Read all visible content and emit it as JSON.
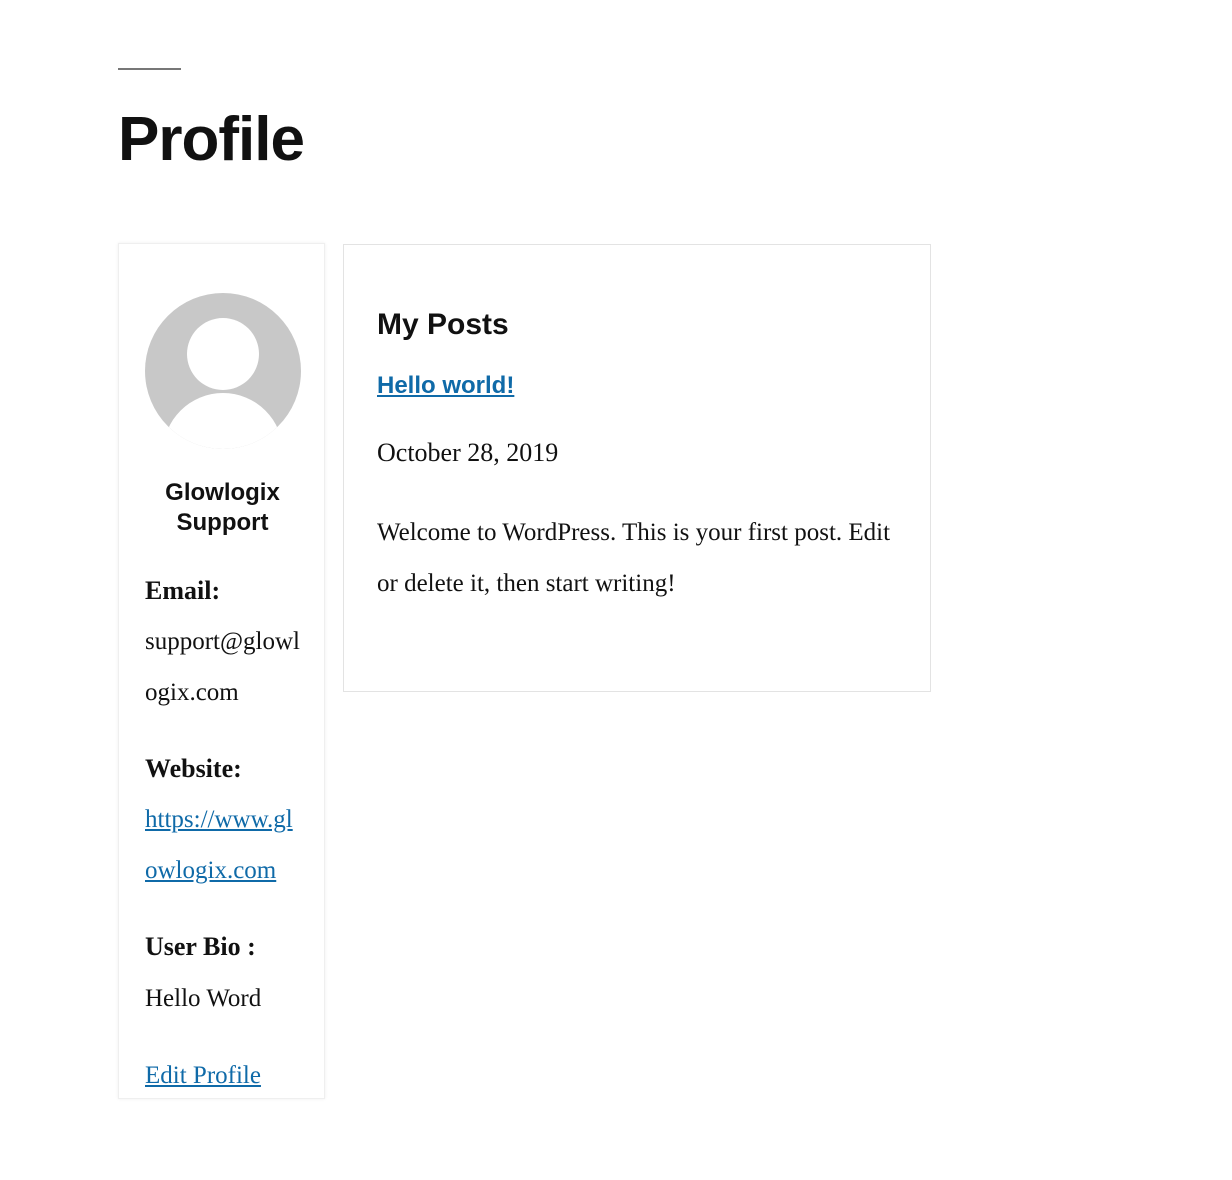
{
  "page": {
    "title": "Profile"
  },
  "profile": {
    "avatar_icon": "default-user-avatar-icon",
    "name": "Glowlogix Support",
    "email_label": "Email:",
    "email_value": "support@glowlogix.com",
    "website_label": "Website:",
    "website_value": "https://www.glowlogix.com",
    "bio_label": "User Bio :",
    "bio_value": "Hello Word",
    "edit_link": "Edit Profile"
  },
  "posts": {
    "heading": "My Posts",
    "items": [
      {
        "title": "Hello world!",
        "date": "October 28, 2019",
        "excerpt": "Welcome to WordPress. This is your first post. Edit or delete it, then start writing!"
      }
    ]
  },
  "colors": {
    "link": "#0f6aa8",
    "text": "#111111",
    "avatar_bg": "#c8c8c8"
  }
}
